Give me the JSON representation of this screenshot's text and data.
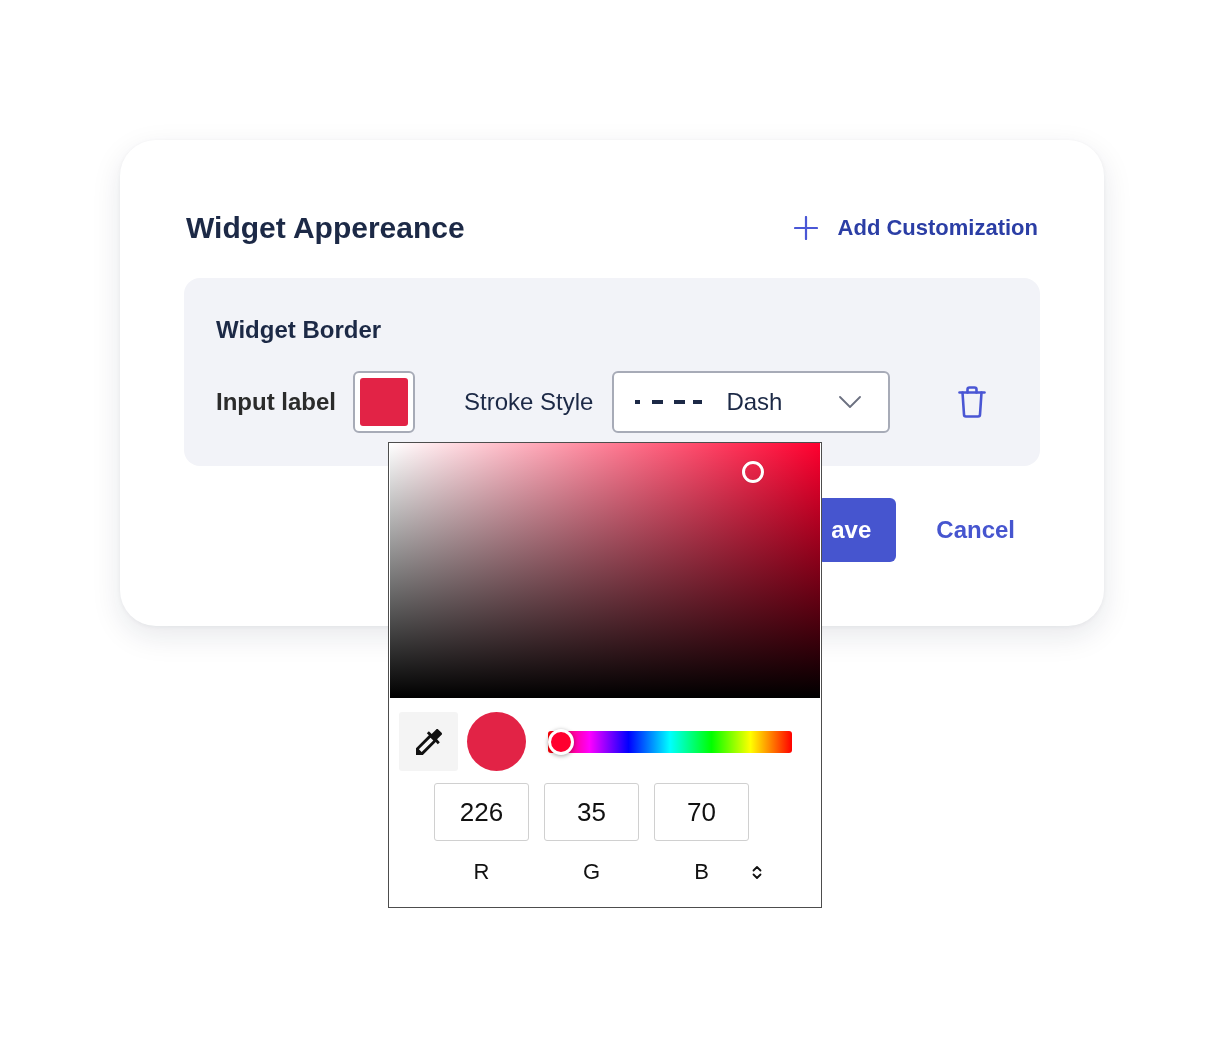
{
  "card": {
    "title": "Widget Appereance",
    "add_button": {
      "label": "Add Customization"
    }
  },
  "widget_border": {
    "title": "Widget Border",
    "color_field": {
      "label": "Input label"
    },
    "stroke_style": {
      "label": "Stroke Style",
      "value": "Dash"
    }
  },
  "color_picker": {
    "hue_slider": {
      "level": 0
    },
    "channels": [
      {
        "label": "R",
        "value": "226"
      },
      {
        "label": "G",
        "value": "35"
      },
      {
        "label": "B",
        "value": "70"
      }
    ]
  },
  "actions": {
    "save": {
      "label": "ave"
    },
    "cancel": {
      "label": "Cancel"
    }
  }
}
